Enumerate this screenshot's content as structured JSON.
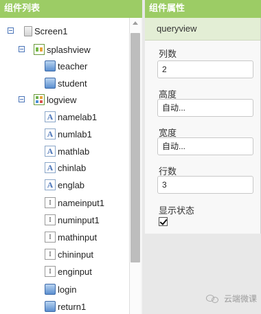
{
  "components_panel": {
    "title": "组件列表",
    "tree": [
      {
        "label": "Screen1",
        "icon": "screen-icon"
      },
      {
        "label": "splashview",
        "icon": "horizontal-arrangement-icon"
      },
      {
        "label": "teacher",
        "icon": "button-icon"
      },
      {
        "label": "student",
        "icon": "button-icon"
      },
      {
        "label": "logview",
        "icon": "table-arrangement-icon"
      },
      {
        "label": "namelab1",
        "icon": "label-icon",
        "glyph": "A"
      },
      {
        "label": "numlab1",
        "icon": "label-icon",
        "glyph": "A"
      },
      {
        "label": "mathlab",
        "icon": "label-icon",
        "glyph": "A"
      },
      {
        "label": "chinlab",
        "icon": "label-icon",
        "glyph": "A"
      },
      {
        "label": "englab",
        "icon": "label-icon",
        "glyph": "A"
      },
      {
        "label": "nameinput1",
        "icon": "textbox-icon",
        "glyph": "I"
      },
      {
        "label": "numinput1",
        "icon": "textbox-icon",
        "glyph": "I"
      },
      {
        "label": "mathinput",
        "icon": "textbox-icon",
        "glyph": "I"
      },
      {
        "label": "chininput",
        "icon": "textbox-icon",
        "glyph": "I"
      },
      {
        "label": "enginput",
        "icon": "textbox-icon",
        "glyph": "I"
      },
      {
        "label": "login",
        "icon": "button-icon"
      },
      {
        "label": "return1",
        "icon": "button-icon"
      }
    ]
  },
  "properties_panel": {
    "title": "组件属性",
    "component_name": "queryview",
    "props": [
      {
        "label": "列数",
        "value": "2"
      },
      {
        "label": "高度",
        "value": "自动..."
      },
      {
        "label": "宽度",
        "value": "自动..."
      },
      {
        "label": "行数",
        "value": "3"
      }
    ],
    "visible_label": "显示状态",
    "visible_checked": true
  },
  "watermark": {
    "text": "云端微课"
  },
  "colors": {
    "header": "#9ccc65",
    "selected_bg": "#e3eed5"
  }
}
